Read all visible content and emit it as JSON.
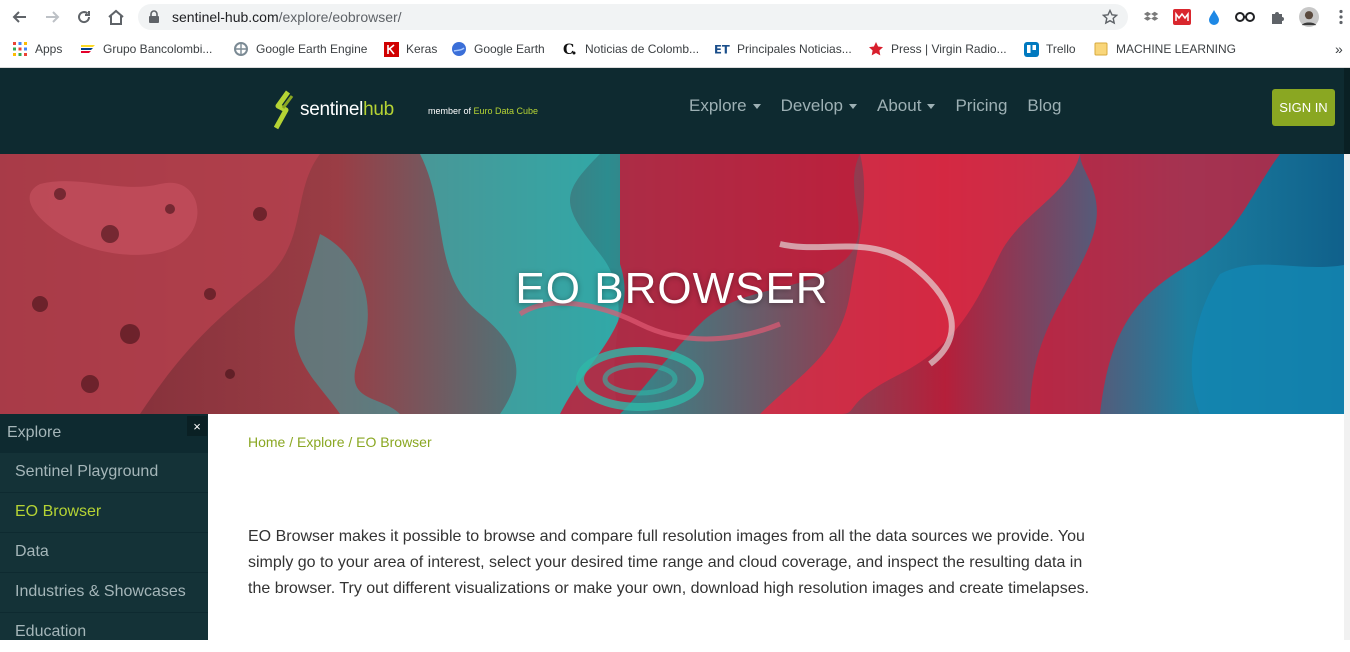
{
  "browser": {
    "url_domain": "sentinel-hub.com",
    "url_path": "/explore/eobrowser/",
    "bookmarks": [
      {
        "label": "Apps",
        "icon": "apps-grid-icon"
      },
      {
        "label": "Grupo Bancolombi...",
        "icon": "bancolombia-icon"
      },
      {
        "label": "Google Earth Engine",
        "icon": "earth-engine-icon"
      },
      {
        "label": "Keras",
        "icon": "keras-icon"
      },
      {
        "label": "Google Earth",
        "icon": "google-earth-icon"
      },
      {
        "label": "Noticias de Colomb...",
        "icon": "noticias-icon"
      },
      {
        "label": "Principales Noticias...",
        "icon": "et-icon"
      },
      {
        "label": "Press | Virgin Radio...",
        "icon": "star-icon"
      },
      {
        "label": "Trello",
        "icon": "trello-icon"
      },
      {
        "label": "MACHINE LEARNING",
        "icon": "folder-icon"
      }
    ],
    "overflow_label": "»"
  },
  "header": {
    "logo_sentinel": "sentinel",
    "logo_hub": "hub",
    "member_prefix": "member of ",
    "member_org": "Euro Data Cube",
    "nav": [
      {
        "label": "Explore",
        "dropdown": true
      },
      {
        "label": "Develop",
        "dropdown": true
      },
      {
        "label": "About",
        "dropdown": true
      },
      {
        "label": "Pricing",
        "dropdown": false
      },
      {
        "label": "Blog",
        "dropdown": false
      }
    ],
    "signin_label": "SIGN IN"
  },
  "hero": {
    "title": "EO BROWSER"
  },
  "sidebar": {
    "title": "Explore",
    "close_label": "×",
    "items": [
      {
        "label": "Sentinel Playground",
        "active": false
      },
      {
        "label": "EO Browser",
        "active": true
      },
      {
        "label": "Data",
        "active": false
      },
      {
        "label": "Industries & Showcases",
        "active": false
      },
      {
        "label": "Education",
        "active": false
      }
    ]
  },
  "main": {
    "breadcrumb": {
      "home": "Home",
      "explore": "Explore",
      "current": "EO Browser",
      "separator": " / "
    },
    "intro": "EO Browser makes it possible to browse and compare full resolution images from all the data sources we provide. You simply go to your area of interest, select your desired time range and cloud coverage, and inspect the resulting data in the browser. Try out different visualizations or make your own, download high resolution images and create timelapses."
  },
  "colors": {
    "header_bg": "#0e2a30",
    "accent_green": "#b5d334",
    "button_green": "#8aa722",
    "sidebar_bg": "#143237"
  }
}
